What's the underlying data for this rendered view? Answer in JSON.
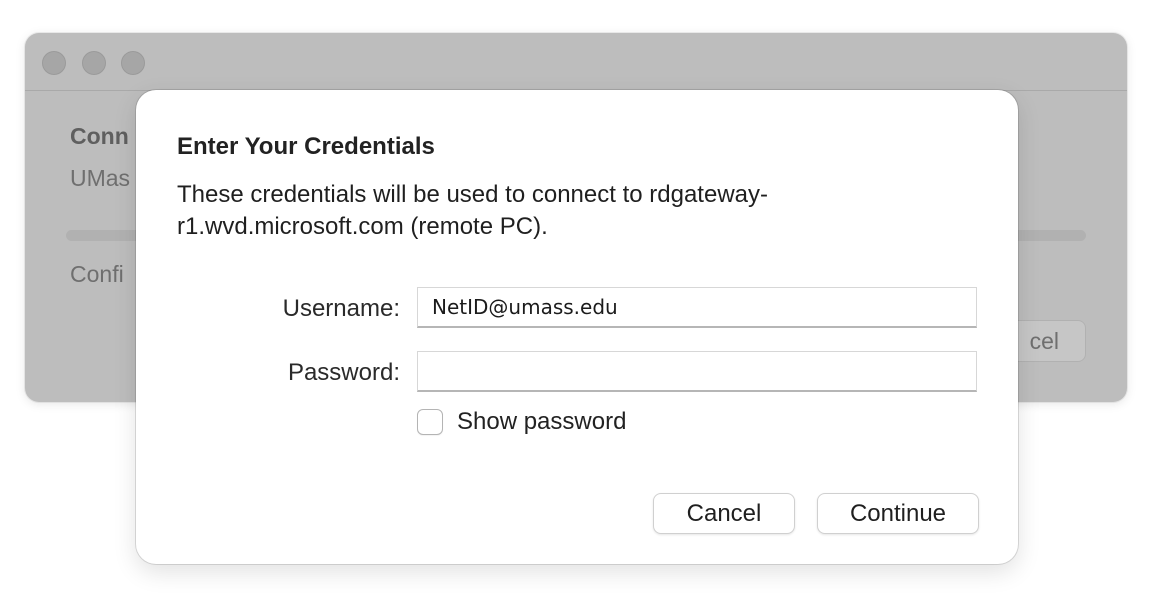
{
  "background_window": {
    "heading": "Conn",
    "subtext": "UMas",
    "status_text": "Confi",
    "cancel_label": "cel"
  },
  "dialog": {
    "title": "Enter Your Credentials",
    "message": "These credentials will be used to connect to rdgateway-r1.wvd.microsoft.com (remote PC).",
    "username": {
      "label": "Username:",
      "value": "NetID@umass.edu"
    },
    "password": {
      "label": "Password:",
      "value": ""
    },
    "show_password": {
      "label": "Show password",
      "checked": false
    },
    "buttons": {
      "cancel": "Cancel",
      "continue": "Continue"
    }
  }
}
